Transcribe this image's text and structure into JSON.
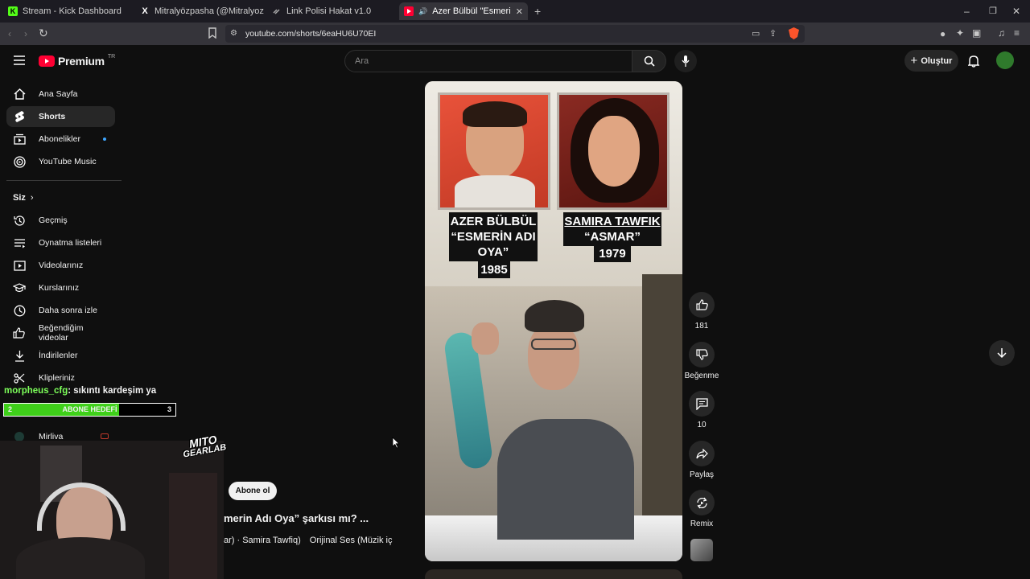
{
  "browser": {
    "tabs": [
      {
        "label": "Stream - Kick Dashboard",
        "favicon": "K",
        "color": "#53fc18"
      },
      {
        "label": "Mitralyözpasha (@Mitralyozpasha) /",
        "favicon": "X",
        "color": "#ffffff"
      },
      {
        "label": "Link Polisi Hakat v1.0",
        "favicon": "link-icon",
        "color": "#aaaaaa"
      },
      {
        "label": "Azer Bülbül \"Esmerin Adı Oya",
        "favicon": "youtube-icon",
        "color": "#ff0033"
      }
    ],
    "url": "youtube.com/shorts/6eaHU6U70EI"
  },
  "header": {
    "logo_text": "Premium",
    "logo_region": "TR",
    "search_placeholder": "Ara",
    "create_label": "Oluştur"
  },
  "sidebar": {
    "main": [
      {
        "label": "Ana Sayfa",
        "icon": "home-icon"
      },
      {
        "label": "Shorts",
        "icon": "shorts-icon",
        "active": true
      },
      {
        "label": "Abonelikler",
        "icon": "subscriptions-icon"
      },
      {
        "label": "YouTube Music",
        "icon": "music-icon"
      }
    ],
    "you_heading": "Siz",
    "you_items": [
      {
        "label": "Geçmiş",
        "icon": "history-icon"
      },
      {
        "label": "Oynatma listeleri",
        "icon": "playlists-icon"
      },
      {
        "label": "Videolarınız",
        "icon": "your-videos-icon"
      },
      {
        "label": "Kurslarınız",
        "icon": "courses-icon"
      },
      {
        "label": "Daha sonra izle",
        "icon": "watch-later-icon"
      },
      {
        "label": "Beğendiğim videolar",
        "icon": "liked-icon"
      },
      {
        "label": "İndirilenler",
        "icon": "download-icon"
      },
      {
        "label": "Klipleriniz",
        "icon": "clips-icon"
      }
    ],
    "subscription_channel": "Mirliva"
  },
  "short": {
    "left_caption": [
      "AZER BÜLBÜL",
      "“ESMERİN ADI",
      "OYA”",
      "1985"
    ],
    "right_caption": [
      "SAMIRA TAWFIK",
      "“ASMAR”",
      "1979"
    ],
    "title_partial": "merin Adı Oya” şarkısı mı? ...",
    "audio_partial": "ar) · Samira Tawfiq)",
    "audio_original": "Orijinal Ses (Müzik iç",
    "subscribe_label": "Abone ol"
  },
  "actions": {
    "likes": "181",
    "dislike_label": "Beğenme",
    "comments": "10",
    "share_label": "Paylaş",
    "remix_label": "Remix"
  },
  "stream_overlay": {
    "chat_user": "morpheus_cfg",
    "chat_message": ": sıkıntı kardeşim ya",
    "goal_label": "ABONE HEDEFİ",
    "goal_current": "2",
    "goal_target": "3",
    "goal_fraction": 0.67,
    "brand_line1": "MITO",
    "brand_line2": "GEARLAB"
  },
  "colors": {
    "accent": "#ff0033",
    "goal_green": "#3fd01a",
    "background": "#0f0f0f"
  }
}
